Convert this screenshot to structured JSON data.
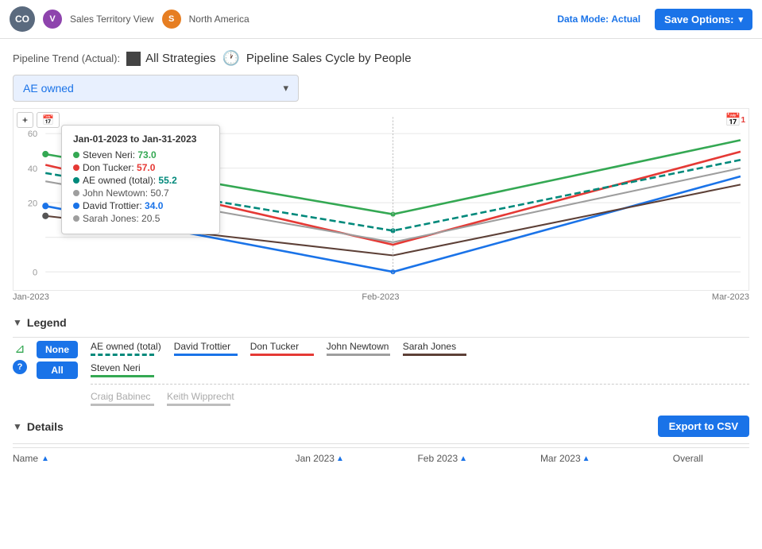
{
  "header": {
    "co_avatar": "CO",
    "v_avatar": "V",
    "s_avatar": "S",
    "sales_territory_label": "Sales Territory View",
    "north_america_label": "North America",
    "data_mode_label": "Data Mode:",
    "data_mode_value": "Actual",
    "save_options_label": "Save Options:"
  },
  "pipeline": {
    "label": "Pipeline Trend (Actual):",
    "strategies_label": "All Strategies",
    "cycle_label": "Pipeline Sales Cycle by People"
  },
  "ae_dropdown": {
    "label": "AE owned",
    "chevron": "▾"
  },
  "chart": {
    "x_labels": [
      "Jan-2023",
      "Feb-2023",
      "Mar-2023"
    ],
    "y_max": 60,
    "calendar_badge": "1"
  },
  "tooltip": {
    "date": "Jan-01-2023 to Jan-31-2023",
    "items": [
      {
        "name": "Steven Neri:",
        "value": "73.0",
        "color": "#34a853",
        "bold": true
      },
      {
        "name": "Don Tucker:",
        "value": "57.0",
        "color": "#e53935",
        "bold": true
      },
      {
        "name": "AE owned (total):",
        "value": "55.2",
        "color": "#00897b",
        "bold": true
      },
      {
        "name": "John Newtown:",
        "value": "50.7",
        "color": "#777",
        "bold": false
      },
      {
        "name": "David Trottier:",
        "value": "34.0",
        "color": "#1a73e8",
        "bold": true
      },
      {
        "name": "Sarah Jones:",
        "value": "20.5",
        "color": "#777",
        "bold": false
      }
    ]
  },
  "legend": {
    "title": "Legend",
    "items": [
      {
        "label": "AE owned (total)",
        "color": "#00897b",
        "dashed": true
      },
      {
        "label": "David Trottier",
        "color": "#1a73e8",
        "dashed": false
      },
      {
        "label": "Don Tucker",
        "color": "#e53935",
        "dashed": false
      },
      {
        "label": "John Newtown",
        "color": "#9e9e9e",
        "dashed": false
      },
      {
        "label": "Sarah Jones",
        "color": "#5d4037",
        "dashed": false
      }
    ],
    "items_row2": [
      {
        "label": "Steven Neri",
        "color": "#34a853",
        "dashed": false
      }
    ],
    "items_row3": [
      {
        "label": "Craig Babinec",
        "color": "#bdbdbd",
        "dashed": false
      },
      {
        "label": "Keith Wipprecht",
        "color": "#bdbdbd",
        "dashed": false
      }
    ],
    "none_label": "None",
    "all_label": "All"
  },
  "details": {
    "title": "Details",
    "export_label": "Export to CSV",
    "columns": [
      "Name",
      "Jan 2023",
      "Feb 2023",
      "Mar 2023",
      "Overall"
    ]
  }
}
